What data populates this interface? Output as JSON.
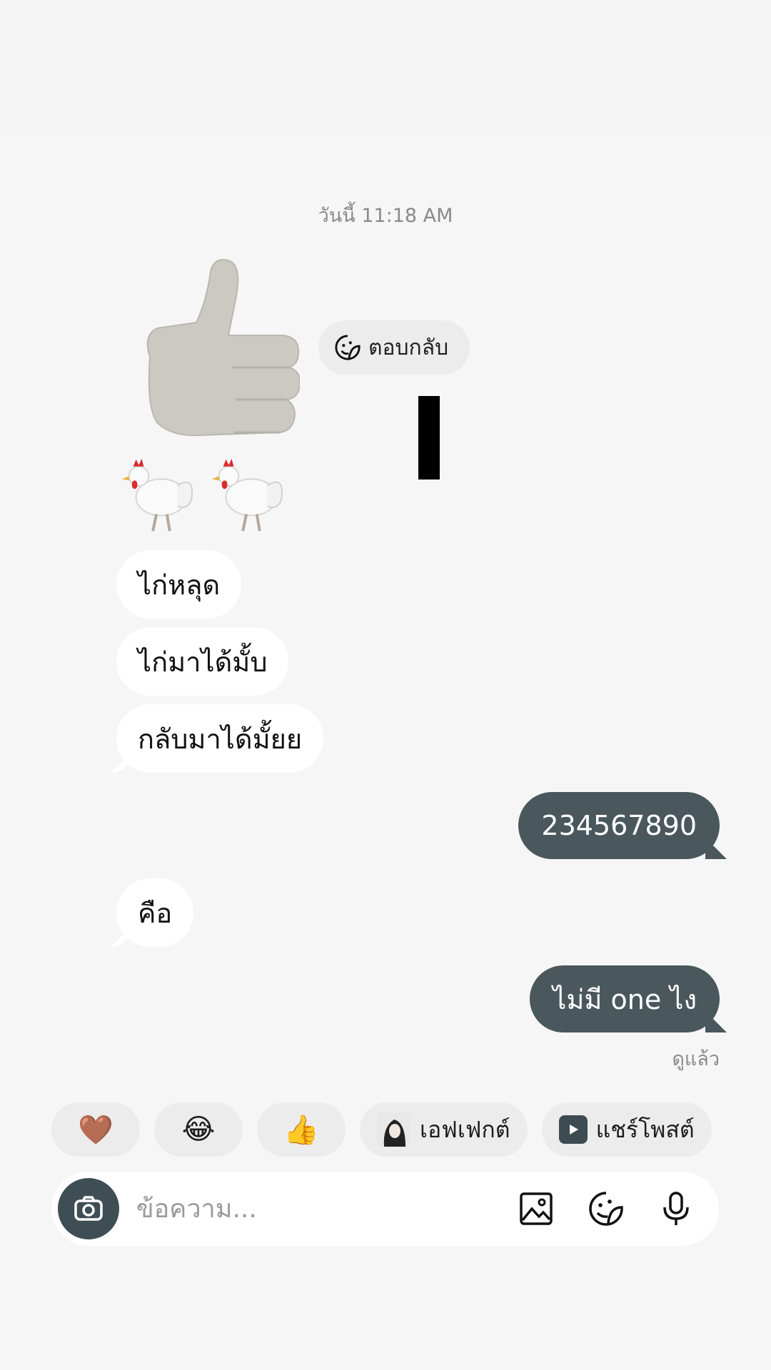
{
  "conversation": {
    "timestamp": "วันนี้ 11:18 AM",
    "reply_chip_label": "ตอบกลับ",
    "messages_in": [
      "ไก่หลุด",
      "ไก่มาได้มั้บ",
      "กลับมาได้มั้ยย",
      "คือ"
    ],
    "messages_out": [
      "234567890",
      "ไม่มี one ไง"
    ],
    "seen_label": "ดูแล้ว"
  },
  "quick_reactions": {
    "heart": "🤎",
    "laugh": "😂",
    "thumbs": "👍",
    "effect_label": "เอฟเฟกต์",
    "share_label": "แชร์โพสต์"
  },
  "composer": {
    "placeholder": "ข้อความ..."
  },
  "colors": {
    "outgoing_bubble": "#4a575d",
    "incoming_bubble": "#ffffff",
    "background": "#f6f6f6"
  }
}
